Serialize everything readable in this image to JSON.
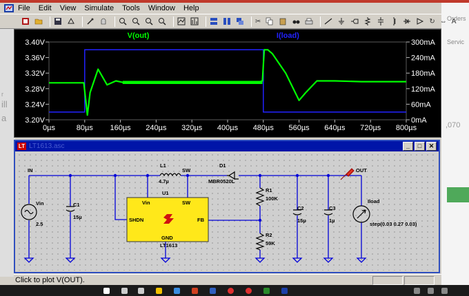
{
  "menu": [
    "File",
    "Edit",
    "View",
    "Simulate",
    "Tools",
    "Window",
    "Help"
  ],
  "background_text": {
    "orders": "Orders",
    "service": "Servic",
    "value": ",070",
    "left_a": "r",
    "left_b": "ill",
    "left_c": "a"
  },
  "waveform": {
    "trace_labels": {
      "vout": "V(out)",
      "iload": "I(load)"
    },
    "colors": {
      "vout": "#00ff00",
      "iload": "#2222ff",
      "grid": "#2a2a2a",
      "axis_text": "#ffffff"
    },
    "left_ticks": [
      "3.40V",
      "3.36V",
      "3.32V",
      "3.28V",
      "3.24V",
      "3.20V"
    ],
    "right_ticks": [
      "300mA",
      "240mA",
      "180mA",
      "120mA",
      "60mA",
      "0mA"
    ],
    "x_ticks": [
      "0µs",
      "80µs",
      "160µs",
      "240µs",
      "320µs",
      "400µs",
      "480µs",
      "560µs",
      "640µs",
      "720µs",
      "800µs"
    ]
  },
  "chart_data": {
    "type": "line",
    "x_unit": "µs",
    "xlim": [
      0,
      800
    ],
    "ylim_left": [
      3.2,
      3.4
    ],
    "ylim_right_mA": [
      0,
      300
    ],
    "series": [
      {
        "name": "V(out)",
        "axis": "left",
        "x": [
          0,
          78,
          86,
          92,
          110,
          130,
          150,
          170,
          200,
          300,
          470,
          478,
          482,
          490,
          500,
          530,
          560,
          575,
          600,
          640,
          700,
          800
        ],
        "y": [
          3.295,
          3.295,
          3.212,
          3.27,
          3.33,
          3.29,
          3.3,
          3.295,
          3.297,
          3.297,
          3.297,
          3.3,
          3.38,
          3.38,
          3.37,
          3.32,
          3.25,
          3.27,
          3.3,
          3.3,
          3.298,
          3.298
        ]
      },
      {
        "name": "I(load)",
        "axis": "right",
        "x": [
          0,
          80,
          80,
          480,
          480,
          800
        ],
        "y": [
          30,
          30,
          270,
          270,
          30,
          30
        ]
      }
    ]
  },
  "schematic": {
    "window_title": "LT1613.asc",
    "window_buttons": [
      "_",
      "□",
      "✕"
    ],
    "net_labels": {
      "in": "IN",
      "sw": "SW",
      "out": "OUT"
    },
    "components": {
      "source": {
        "name": "Vin",
        "value": "2.5"
      },
      "c1": {
        "name": "C1",
        "value": "15µ"
      },
      "l1": {
        "name": "L1",
        "value": "4.7µ"
      },
      "d1": {
        "name": "D1",
        "value": "MBR0520L"
      },
      "r1": {
        "name": "R1",
        "value": "100K"
      },
      "r2": {
        "name": "R2",
        "value": "59K"
      },
      "c2": {
        "name": "C2",
        "value": "15µ"
      },
      "c3": {
        "name": "C3",
        "value": "1µ"
      },
      "load": {
        "name": "Iload",
        "value": "step(0.03 0.27 0.03)"
      },
      "u1": {
        "name": "U1",
        "part": "LT1613",
        "logo": "LT",
        "pins": {
          "vin": "Vin",
          "sw": "SW",
          "shdn": "SHDN",
          "fb": "FB",
          "gnd": "GND"
        }
      }
    }
  },
  "status": {
    "text": "Click to plot V(OUT)."
  }
}
